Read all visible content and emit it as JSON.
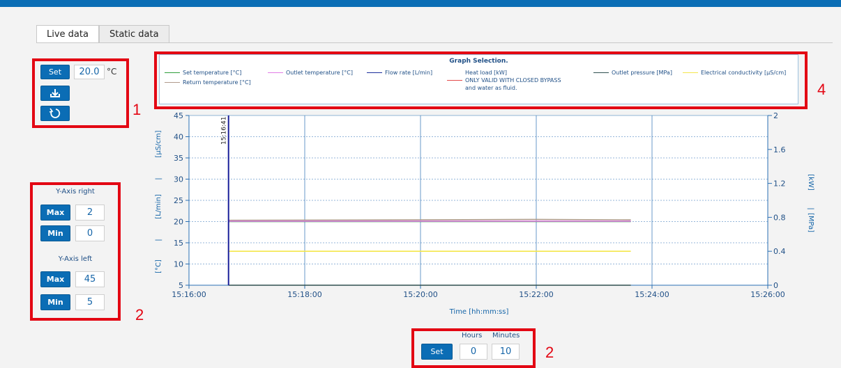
{
  "tabs": [
    {
      "label": "Live data",
      "active": true
    },
    {
      "label": "Static data",
      "active": false
    }
  ],
  "setpoint": {
    "set_label": "Set",
    "value": "20.0",
    "unit": "°C",
    "icons": [
      "download-icon",
      "refresh-icon"
    ]
  },
  "y_axis_right": {
    "title": "Y-Axis right",
    "max_label": "Max",
    "max_value": "2",
    "min_label": "Min",
    "min_value": "0"
  },
  "y_axis_left": {
    "title": "Y-Axis left",
    "max_label": "Max",
    "max_value": "45",
    "min_label": "Min",
    "min_value": "5"
  },
  "time_window": {
    "hours_label": "Hours",
    "minutes_label": "Minutes",
    "set_label": "Set",
    "hours_value": "0",
    "minutes_value": "10"
  },
  "callouts": {
    "c1": "1",
    "c2a": "2",
    "c2b": "2",
    "c4": "4"
  },
  "legend": {
    "title": "Graph Selection.",
    "items": [
      {
        "label": "Set temperature [°C]",
        "color": "#2e9e3a"
      },
      {
        "label": "Return temperature [°C]",
        "color": "#b09a8c"
      },
      {
        "label": "Outlet temperature [°C]",
        "color": "#e27ce6"
      },
      {
        "label": "Flow rate [L/min]",
        "color": "#1a2d9a"
      },
      {
        "label": "Heat load [kW]",
        "color": ""
      },
      {
        "label": "ONLY VALID WITH CLOSED BYPASS",
        "color": "#e34b4b"
      },
      {
        "label": "and water as fluid.",
        "color": ""
      },
      {
        "label": "Outlet pressure [MPa]",
        "color": "#2f4f4f"
      },
      {
        "label": "Electrical conductivity [µS/cm]",
        "color": "#f4e64a"
      }
    ]
  },
  "chart_data": {
    "type": "line",
    "xlabel": "Time [hh:mm:ss]",
    "x_ticks": [
      "15:16:00",
      "15:18:00",
      "15:20:00",
      "15:22:00",
      "15:24:00",
      "15:26:00"
    ],
    "xlim": [
      "15:16:00",
      "15:26:00"
    ],
    "y_left": {
      "ylim": [
        5,
        45
      ],
      "ticks": [
        5,
        10,
        15,
        20,
        25,
        30,
        35,
        40,
        45
      ],
      "label_segments": [
        "[°C]",
        "|",
        "[L/min]",
        "|",
        "[µS/cm]"
      ]
    },
    "y_right": {
      "ylim": [
        0,
        2
      ],
      "ticks": [
        "0",
        "0.4",
        "0.8",
        "1.2",
        "1.6",
        "2"
      ],
      "label_segments": [
        "[kW]",
        "|",
        "[MPa]"
      ]
    },
    "marker": {
      "time": "15:16:41",
      "label": "15:16:41"
    },
    "grid": true,
    "series": [
      {
        "name": "Set temperature [°C]",
        "axis": "left",
        "color": "#2e9e3a",
        "x": [
          "15:16:41",
          "15:23:38"
        ],
        "y": [
          20.0,
          20.0
        ]
      },
      {
        "name": "Return temperature [°C]",
        "axis": "left",
        "color": "#b09a8c",
        "x": [
          "15:16:41",
          "15:20:00",
          "15:22:00",
          "15:23:38"
        ],
        "y": [
          20.3,
          20.4,
          20.5,
          20.4
        ]
      },
      {
        "name": "Outlet temperature [°C]",
        "axis": "left",
        "color": "#e27ce6",
        "x": [
          "15:16:41",
          "15:23:38"
        ],
        "y": [
          20.1,
          20.1
        ]
      },
      {
        "name": "Electrical conductivity [µS/cm]",
        "axis": "left",
        "color": "#f4e64a",
        "x": [
          "15:16:41",
          "15:23:38"
        ],
        "y": [
          13.0,
          13.0
        ]
      },
      {
        "name": "Outlet pressure [MPa]",
        "axis": "right",
        "color": "#2f4f4f",
        "x": [
          "15:16:41",
          "15:23:38"
        ],
        "y": [
          0.0,
          0.0
        ]
      }
    ]
  }
}
